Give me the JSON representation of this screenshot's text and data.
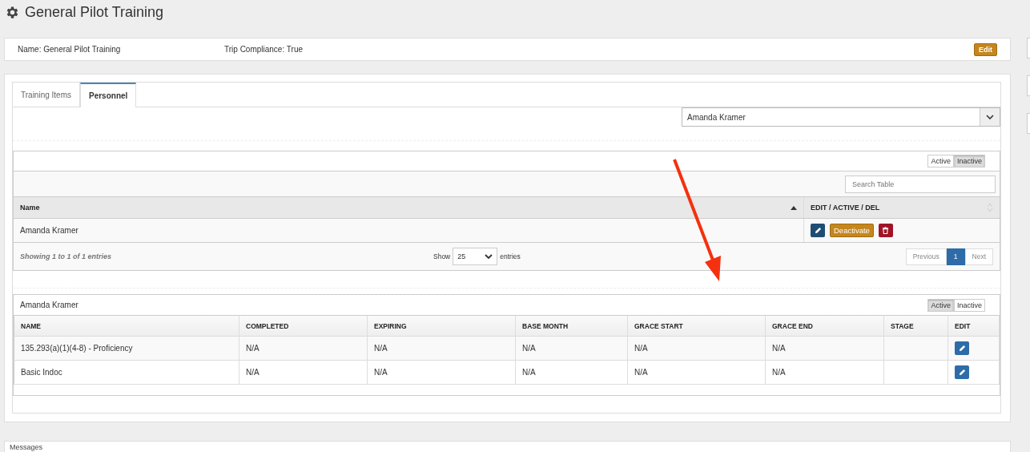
{
  "page": {
    "title": "General Pilot Training"
  },
  "info": {
    "fields": [
      "Name: General Pilot Training",
      "Trip Compliance: True"
    ],
    "edit_button": "Edit"
  },
  "tabs": [
    {
      "label": "Training Items",
      "selected": false
    },
    {
      "label": "Personnel",
      "selected": true
    }
  ],
  "person_select": {
    "value": "Amanda Kramer"
  },
  "personnel_table": {
    "filter": [
      {
        "label": "Active",
        "selected": false
      },
      {
        "label": "Inactive",
        "selected": true
      }
    ],
    "search": {
      "placeholder": "Search Table"
    },
    "columns": [
      "Name",
      "EDIT / ACTIVE / DEL"
    ],
    "rows": [
      {
        "name": "Amanda Kramer",
        "toggle_button": "Deactivate"
      }
    ],
    "summary": "Showing 1 to 1 of 1 entries",
    "show_label": "Show",
    "page_size": "25",
    "entries_label": "entries",
    "pagination": [
      {
        "label": "Previous",
        "selected": false
      },
      {
        "label": "1",
        "selected": true
      },
      {
        "label": "Next",
        "selected": false
      }
    ]
  },
  "training_table": {
    "title": "Amanda Kramer",
    "filter": [
      {
        "label": "Active",
        "selected": true
      },
      {
        "label": "Inactive",
        "selected": false
      }
    ],
    "columns": [
      "NAME",
      "COMPLETED",
      "EXPIRING",
      "BASE MONTH",
      "GRACE START",
      "GRACE END",
      "STAGE",
      "EDIT"
    ],
    "rows": [
      {
        "cells": [
          "135.293(a)(1)(4-8) - Proficiency",
          "N/A",
          "N/A",
          "N/A",
          "N/A",
          "N/A"
        ]
      },
      {
        "cells": [
          "Basic Indoc",
          "N/A",
          "N/A",
          "N/A",
          "N/A",
          "N/A"
        ]
      }
    ]
  },
  "messages": {
    "title": "Messages"
  }
}
